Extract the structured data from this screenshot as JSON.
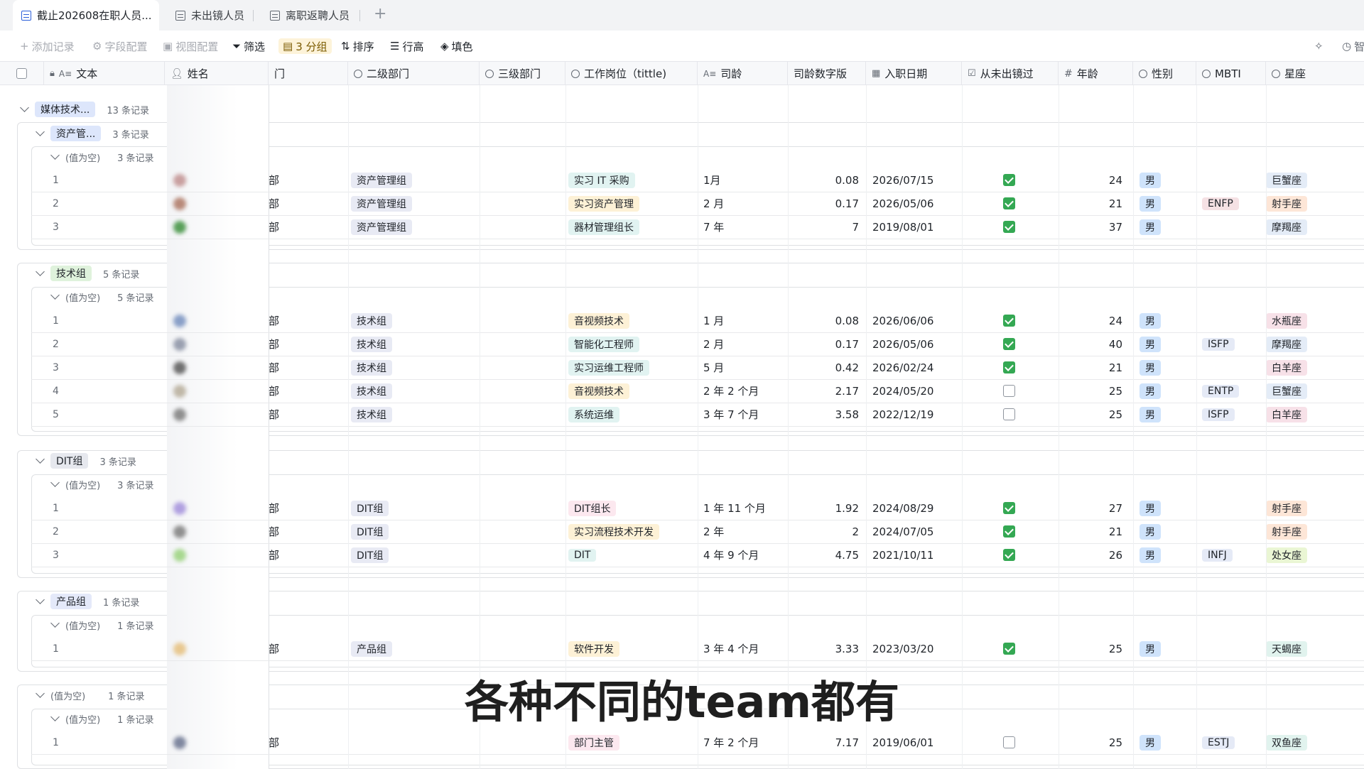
{
  "tabs": [
    {
      "label": "截止202608在职人员...",
      "active": true
    },
    {
      "label": "未出镜人员",
      "active": false
    },
    {
      "label": "离职返聘人员",
      "active": false
    }
  ],
  "tab_add": "+",
  "toolbar": {
    "add_record": "添加记录",
    "field_config": "字段配置",
    "view_config": "视图配置",
    "filter": "筛选",
    "group": "3 分组",
    "sort": "排序",
    "row_height": "行高",
    "fill": "填色",
    "right_label": "智"
  },
  "headers": {
    "text": "文本",
    "text_type": "A≡",
    "name": "姓名",
    "dept1_partial": "门",
    "dept2": "二级部门",
    "dept3": "三级部门",
    "job": "工作岗位（tittle)",
    "tenure": "司龄",
    "tenure_type": "A≡",
    "tenure_num": "司龄数字版",
    "join_date": "入职日期",
    "never_on_camera": "从未出镜过",
    "age": "年龄",
    "gender": "性别",
    "mbti": "MBTI",
    "sign": "星座"
  },
  "groups": {
    "g1": {
      "label": "媒体技术...",
      "count": "13 条记录"
    },
    "g1a": {
      "label": "资产管...",
      "count": "3 条记录"
    },
    "g1a_null": {
      "label": "(值为空)",
      "count": "3 条记录"
    },
    "g1b": {
      "label": "技术组",
      "count": "5 条记录"
    },
    "g1b_null": {
      "label": "(值为空)",
      "count": "5 条记录"
    },
    "g1c": {
      "label": "DIT组",
      "count": "3 条记录"
    },
    "g1c_null": {
      "label": "(值为空)",
      "count": "3 条记录"
    },
    "g1d": {
      "label": "产品组",
      "count": "1 条记录"
    },
    "g1d_null": {
      "label": "(值为空)",
      "count": "1 条记录"
    },
    "g2": {
      "label": "(值为空)",
      "count": "1 条记录"
    },
    "g2_null": {
      "label": "(值为空)",
      "count": "1 条记录"
    }
  },
  "rows": [
    {
      "idx": "1",
      "dept1": "部",
      "dept2": "资产管理组",
      "job": "实习 IT 采购",
      "tenure": "1月",
      "tenure_num": "0.08",
      "date": "2026/07/15",
      "checked": true,
      "age": "24",
      "gender": "男",
      "mbti": "",
      "sign": "巨蟹座"
    },
    {
      "idx": "2",
      "dept1": "部",
      "dept2": "资产管理组",
      "job": "实习资产管理",
      "tenure": "2 月",
      "tenure_num": "0.17",
      "date": "2026/05/06",
      "checked": true,
      "age": "21",
      "gender": "男",
      "mbti": "ENFP",
      "sign": "射手座"
    },
    {
      "idx": "3",
      "dept1": "部",
      "dept2": "资产管理组",
      "job": "器材管理组长",
      "tenure": "7 年",
      "tenure_num": "7",
      "date": "2019/08/01",
      "checked": true,
      "age": "37",
      "gender": "男",
      "mbti": "",
      "sign": "摩羯座"
    },
    {
      "idx": "1",
      "dept1": "部",
      "dept2": "技术组",
      "job": "音视频技术",
      "tenure": "1 月",
      "tenure_num": "0.08",
      "date": "2026/06/06",
      "checked": true,
      "age": "24",
      "gender": "男",
      "mbti": "",
      "sign": "水瓶座"
    },
    {
      "idx": "2",
      "dept1": "部",
      "dept2": "技术组",
      "job": "智能化工程师",
      "tenure": "2 月",
      "tenure_num": "0.17",
      "date": "2026/05/06",
      "checked": true,
      "age": "40",
      "gender": "男",
      "mbti": "ISFP",
      "sign": "摩羯座"
    },
    {
      "idx": "3",
      "dept1": "部",
      "dept2": "技术组",
      "job": "实习运维工程师",
      "tenure": "5 月",
      "tenure_num": "0.42",
      "date": "2026/02/24",
      "checked": true,
      "age": "21",
      "gender": "男",
      "mbti": "",
      "sign": "白羊座"
    },
    {
      "idx": "4",
      "dept1": "部",
      "dept2": "技术组",
      "job": "音视频技术",
      "tenure": "2 年 2 个月",
      "tenure_num": "2.17",
      "date": "2024/05/20",
      "checked": false,
      "age": "25",
      "gender": "男",
      "mbti": "ENTP",
      "sign": "巨蟹座"
    },
    {
      "idx": "5",
      "dept1": "部",
      "dept2": "技术组",
      "job": "系统运维",
      "tenure": "3 年 7 个月",
      "tenure_num": "3.58",
      "date": "2022/12/19",
      "checked": false,
      "age": "25",
      "gender": "男",
      "mbti": "ISFP",
      "sign": "白羊座"
    },
    {
      "idx": "1",
      "dept1": "部",
      "dept2": "DIT组",
      "job": "DIT组长",
      "tenure": "1 年 11 个月",
      "tenure_num": "1.92",
      "date": "2024/08/29",
      "checked": true,
      "age": "27",
      "gender": "男",
      "mbti": "",
      "sign": "射手座"
    },
    {
      "idx": "2",
      "dept1": "部",
      "dept2": "DIT组",
      "job": "实习流程技术开发",
      "tenure": "2 年",
      "tenure_num": "2",
      "date": "2024/07/05",
      "checked": true,
      "age": "21",
      "gender": "男",
      "mbti": "",
      "sign": "射手座"
    },
    {
      "idx": "3",
      "dept1": "部",
      "dept2": "DIT组",
      "job": "DIT",
      "tenure": "4 年 9 个月",
      "tenure_num": "4.75",
      "date": "2021/10/11",
      "checked": true,
      "age": "26",
      "gender": "男",
      "mbti": "INFJ",
      "sign": "处女座"
    },
    {
      "idx": "1",
      "dept1": "部",
      "dept2": "产品组",
      "job": "软件开发",
      "tenure": "3 年 4 个月",
      "tenure_num": "3.33",
      "date": "2023/03/20",
      "checked": true,
      "age": "25",
      "gender": "男",
      "mbti": "",
      "sign": "天蝎座"
    },
    {
      "idx": "1",
      "dept1": "部",
      "dept2": "",
      "job": "部门主管",
      "tenure": "7 年 2 个月",
      "tenure_num": "7.17",
      "date": "2019/06/01",
      "checked": false,
      "age": "25",
      "gender": "男",
      "mbti": "ESTJ",
      "sign": "双鱼座"
    }
  ],
  "caption": "各种不同的team都有",
  "colors": {
    "accent": "#2b5fd9",
    "check": "#34a853",
    "group_active": "#fdf3d9"
  }
}
